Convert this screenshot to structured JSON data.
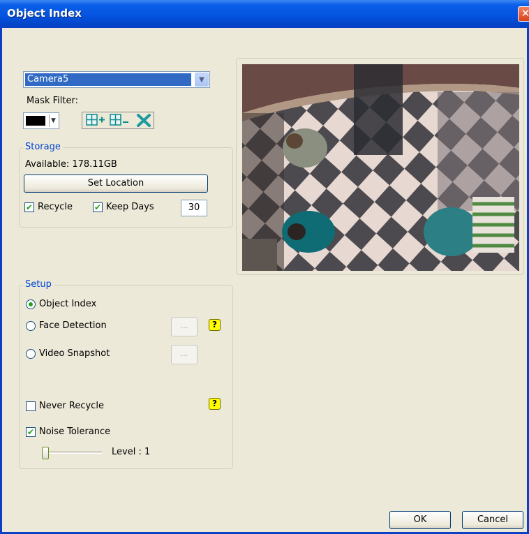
{
  "window": {
    "title": "Object Index",
    "close_glyph": "✕"
  },
  "camera": {
    "selected": "Camera5"
  },
  "mask_filter": {
    "label": "Mask Filter:",
    "color": "#000000",
    "tools": [
      "grid-add-icon",
      "grid-remove-icon",
      "clear-icon"
    ]
  },
  "storage": {
    "title": "Storage",
    "available": "Available: 178.11GB",
    "set_location": "Set Location",
    "recycle": {
      "label": "Recycle",
      "checked": true
    },
    "keep_days": {
      "label": "Keep Days",
      "checked": true,
      "value": "30"
    }
  },
  "setup": {
    "title": "Setup",
    "object_index": {
      "label": "Object Index",
      "selected": true
    },
    "face_detection": {
      "label": "Face Detection",
      "selected": false,
      "button": "..."
    },
    "video_snapshot": {
      "label": "Video Snapshot",
      "selected": false,
      "button": "..."
    },
    "never_recycle": {
      "label": "Never Recycle",
      "checked": false
    },
    "noise_tolerance": {
      "label": "Noise Tolerance",
      "checked": true
    },
    "level": {
      "label": "Level : 1",
      "value": 1
    },
    "help_glyph": "?"
  },
  "buttons": {
    "ok": "OK",
    "cancel": "Cancel"
  },
  "colors": {
    "title_bar": "#0454e0",
    "accent": "#316ac5",
    "dialog_bg": "#ece9d8",
    "group_title": "#0046d5"
  }
}
